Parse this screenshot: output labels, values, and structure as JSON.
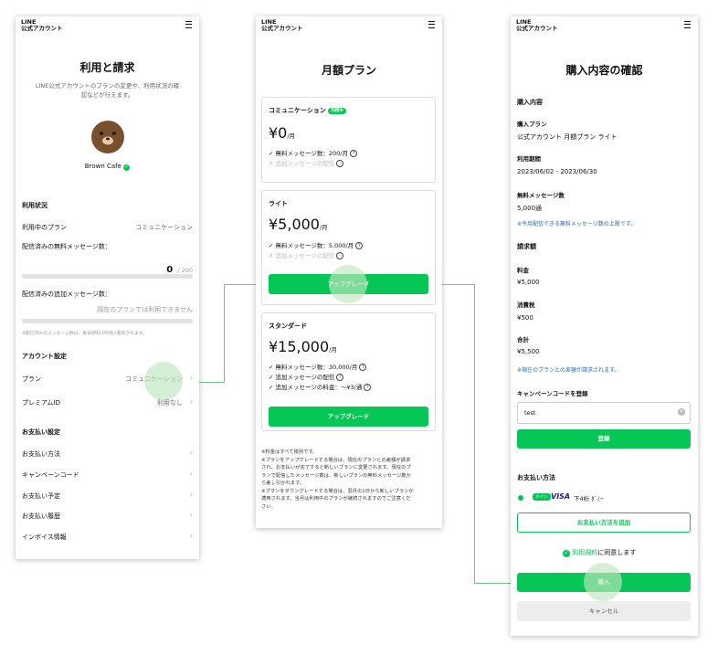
{
  "header": {
    "logo_line1": "LINE",
    "logo_line2": "公式アカウント"
  },
  "screen1": {
    "title": "利用と請求",
    "description_line1": "LINE公式アカウントのプランの変更や、利用状況の確",
    "description_line2": "認などが行えます。",
    "account_name": "Brown Cafe",
    "usage_heading": "利用状況",
    "current_plan_label": "利用中のプラン",
    "current_plan_value": "コミュニケーション",
    "free_messages_label": "配信済みの無料メッセージ数：",
    "free_messages_count": "0",
    "free_messages_limit": "/ 200",
    "free_messages_progress": 0,
    "additional_messages_label": "配信済みの追加メッセージ数：",
    "additional_messages_note": "現在のプランでは利用できません",
    "update_note": "※配信済みのメッセージ数は、毎日AM2:00頃に更新されます。",
    "account_settings_heading": "アカウント設定",
    "plan_label": "プラン",
    "plan_value": "コミュニケーション",
    "premium_id_label": "プレミアムID",
    "premium_id_value": "利用なし",
    "payment_settings_heading": "お支払い設定",
    "payment_items": [
      "お支払い方法",
      "キャンペーンコード",
      "お支払い予定",
      "お支払い履歴",
      "インボイス情報"
    ]
  },
  "screen2": {
    "title": "月額プラン",
    "plans": [
      {
        "name": "コミュニケーション",
        "badge": "利用中",
        "price": "¥0",
        "unit": "/月",
        "features": [
          {
            "text": "無料メッセージ数：200/月",
            "enabled": true
          },
          {
            "text": "追加メッセージの配信",
            "enabled": false
          }
        ]
      },
      {
        "name": "ライト",
        "price": "¥5,000",
        "unit": "/月",
        "button": "アップグレード",
        "features": [
          {
            "text": "無料メッセージ数：5,000/月",
            "enabled": true
          },
          {
            "text": "追加メッセージの配信",
            "enabled": false
          }
        ]
      },
      {
        "name": "スタンダード",
        "price": "¥15,000",
        "unit": "/月",
        "button": "アップグレード",
        "features": [
          {
            "text": "無料メッセージ数：30,000/月",
            "enabled": true
          },
          {
            "text": "追加メッセージの配信",
            "enabled": true
          },
          {
            "text": "追加メッセージの料金：〜¥3/通",
            "enabled": true
          }
        ]
      }
    ],
    "notes": [
      "※料金はすべて税別です。",
      "※プランをアップグレードする場合は、現在のプランとの差額が請求",
      "され、お支払いが完了すると新しいプランに変更されます。現在のプ",
      "ランで配信したメッセージ数は、新しいプランの無料メッセージ数か",
      "ら差し引かれます。",
      "※プランをダウングレードする場合は、翌月の1日から新しいプランが",
      "適用されます。当月は利用中のプランが継続されますのでご注意くだ",
      "さい。"
    ]
  },
  "screen3": {
    "title": "購入内容の確認",
    "purchase_heading": "購入内容",
    "plan_label": "購入プラン",
    "plan_value": "公式アカウント 月額プラン ライト",
    "period_label": "利用期間",
    "period_value": "2023/06/02 - 2023/06/30",
    "free_label": "無料メッセージ数",
    "free_value": "5,000通",
    "free_note": "※今月配信できる無料メッセージ数の上限です。",
    "billing_heading": "請求額",
    "fee_label": "料金",
    "fee_value": "¥5,000",
    "tax_label": "消費税",
    "tax_value": "¥500",
    "total_label": "合計",
    "total_value": "¥5,500",
    "diff_note": "※現在のプランとの差額が請求されます。",
    "campaign_label": "キャンペーンコードを登録",
    "campaign_input_value": "test",
    "register_button": "登録",
    "payment_heading": "お支払い方法",
    "main_badge": "メイン",
    "card_brand": "VISA",
    "card_last4": "下4桁 ﾀﾞﾐｰ",
    "add_payment_button": "お支払い方法を追加",
    "terms_link": "利用規約",
    "terms_text": "に同意します",
    "purchase_button": "購入",
    "cancel_button": "キャンセル"
  },
  "colors": {
    "accent": "#06c755",
    "link": "#2b6cb0",
    "connector": "#6dca85"
  }
}
